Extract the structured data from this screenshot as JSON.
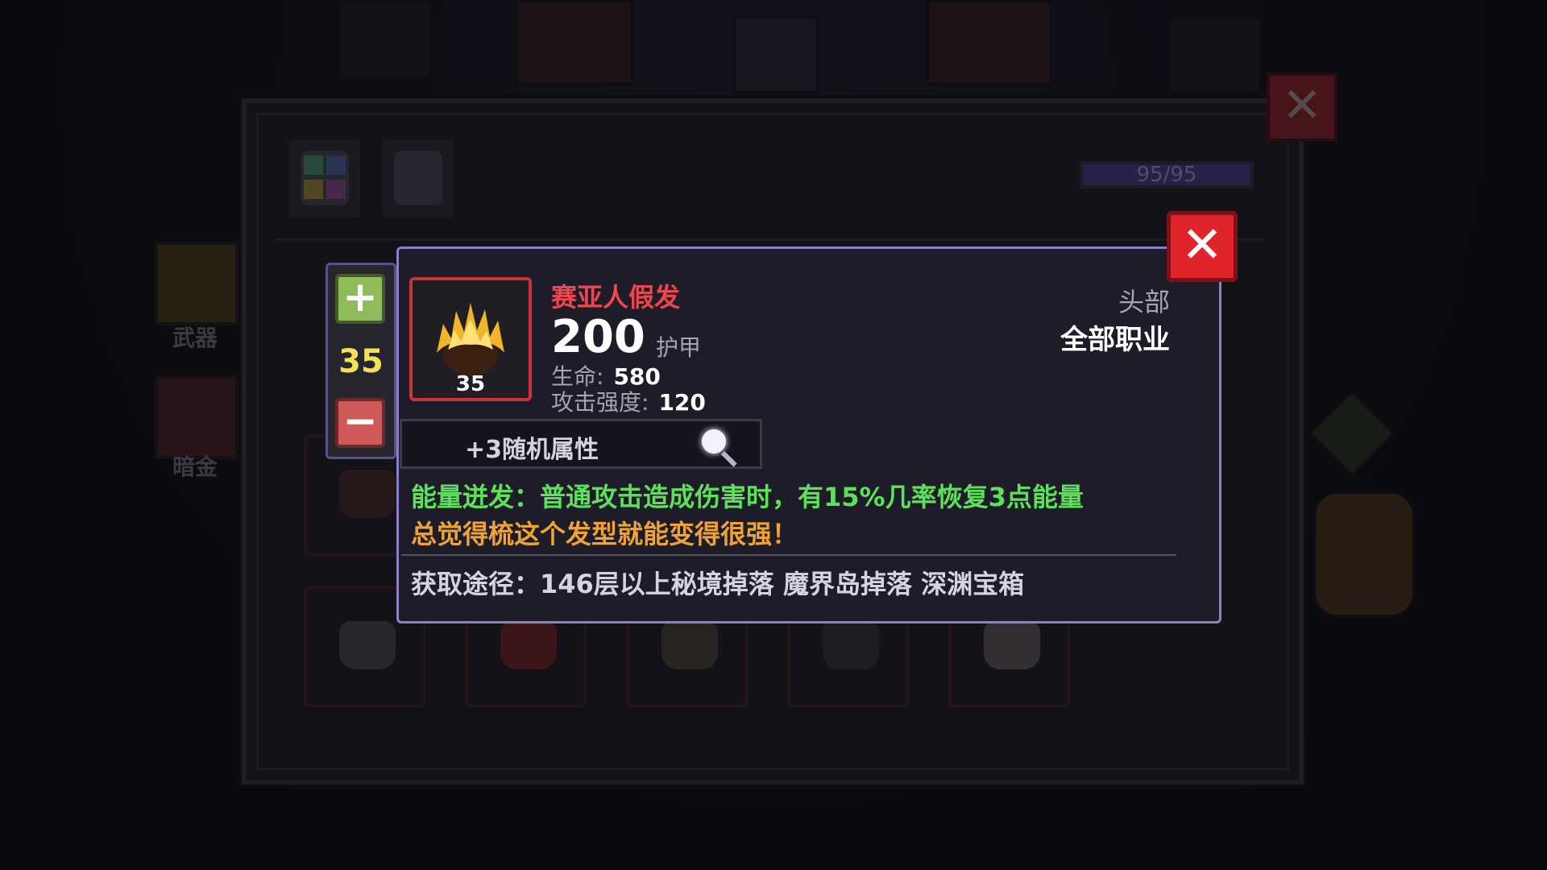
{
  "background": {
    "side_tabs": [
      {
        "label": "武器"
      },
      {
        "label": "暗金"
      }
    ],
    "energy": "95/95"
  },
  "level_adjuster": {
    "level": "35",
    "plus_icon": "plus-icon",
    "minus_icon": "minus-icon"
  },
  "tooltip": {
    "item_name": "赛亚人假发",
    "item_icon": "flame-hair-icon",
    "item_level": "35",
    "armor_value": "200",
    "armor_label": "护甲",
    "stats": [
      {
        "label": "生命:",
        "value": "580"
      },
      {
        "label": "攻击强度:",
        "value": "120"
      }
    ],
    "slot_type": "头部",
    "class_restriction": "全部职业",
    "random_attributes": "+3随机属性",
    "effect": "能量迸发：普通攻击造成伤害时，有15%几率恢复3点能量",
    "flavor": "总觉得梳这个发型就能变得很强！",
    "source": "获取途径：146层以上秘境掉落 魔界岛掉落 深渊宝箱"
  },
  "colors": {
    "item_name": "#e8484e",
    "effect": "#5de05a",
    "flavor": "#f0a335",
    "level": "#f3e15a",
    "close_button": "#e0242c"
  }
}
